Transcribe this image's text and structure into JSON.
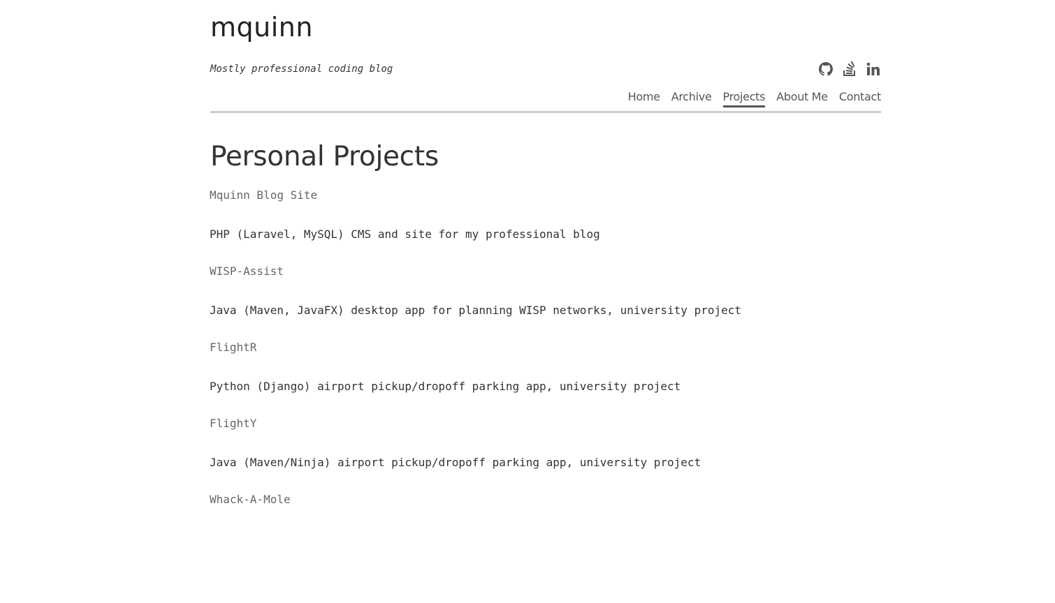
{
  "site": {
    "title": "mquinn",
    "tagline": "Mostly professional coding blog"
  },
  "social": [
    {
      "name": "github-icon",
      "label": "GitHub"
    },
    {
      "name": "stackoverflow-icon",
      "label": "Stack Overflow"
    },
    {
      "name": "linkedin-icon",
      "label": "LinkedIn"
    }
  ],
  "nav": {
    "items": [
      {
        "label": "Home"
      },
      {
        "label": "Archive"
      },
      {
        "label": "Projects"
      },
      {
        "label": "About Me"
      },
      {
        "label": "Contact"
      }
    ],
    "active": "Projects"
  },
  "main": {
    "heading": "Personal Projects",
    "projects": [
      {
        "name": "Mquinn Blog Site",
        "description": "PHP (Laravel, MySQL) CMS and site for my professional blog"
      },
      {
        "name": "WISP-Assist",
        "description": "Java (Maven, JavaFX) desktop app for planning WISP networks, university project"
      },
      {
        "name": "FlightR",
        "description": "Python (Django) airport pickup/dropoff parking app, university project"
      },
      {
        "name": "FlightY",
        "description": "Java (Maven/Ninja) airport pickup/dropoff parking app, university project"
      },
      {
        "name": "Whack-A-Mole",
        "description": ""
      }
    ]
  },
  "colors": {
    "text": "#333333",
    "link": "#666666",
    "nav": "#555555",
    "rule": "#cccccc"
  }
}
